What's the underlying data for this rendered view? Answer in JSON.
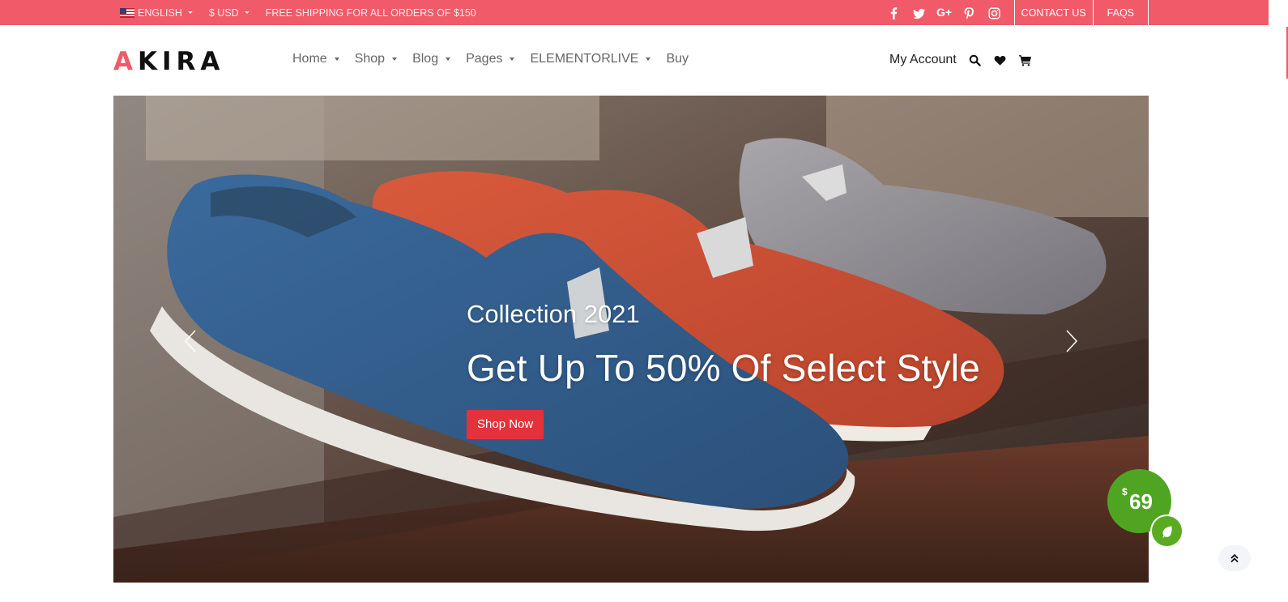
{
  "topbar": {
    "language": "ENGLISH",
    "currency": "$ USD",
    "shipping_notice": "FREE SHIPPING FOR ALL ORDERS OF $150",
    "social_icons": [
      "facebook-icon",
      "twitter-icon",
      "google-plus-icon",
      "pinterest-icon",
      "instagram-icon"
    ],
    "google_plus_glyph": "G+",
    "contact_label": "CONTACT US",
    "faqs_label": "FAQS",
    "color": "#f05a69"
  },
  "header": {
    "logo_first": "A",
    "logo_rest": "KIRA",
    "nav": [
      {
        "label": "Home",
        "has_dropdown": true
      },
      {
        "label": "Shop",
        "has_dropdown": true
      },
      {
        "label": "Blog",
        "has_dropdown": true
      },
      {
        "label": "Pages",
        "has_dropdown": true
      },
      {
        "label": "ELEMENTORLIVE",
        "has_dropdown": true
      },
      {
        "label": "Buy",
        "has_dropdown": false
      }
    ],
    "account_label": "My Account",
    "icons": [
      "search-icon",
      "heart-icon",
      "cart-icon"
    ]
  },
  "hero": {
    "subtitle": "Collection 2021",
    "title": "Get Up To 50% Of Select Style",
    "button_label": "Shop Now",
    "button_color": "#e3323c"
  },
  "price_badge": {
    "currency": "$",
    "amount": "69",
    "color": "#4fa522"
  }
}
